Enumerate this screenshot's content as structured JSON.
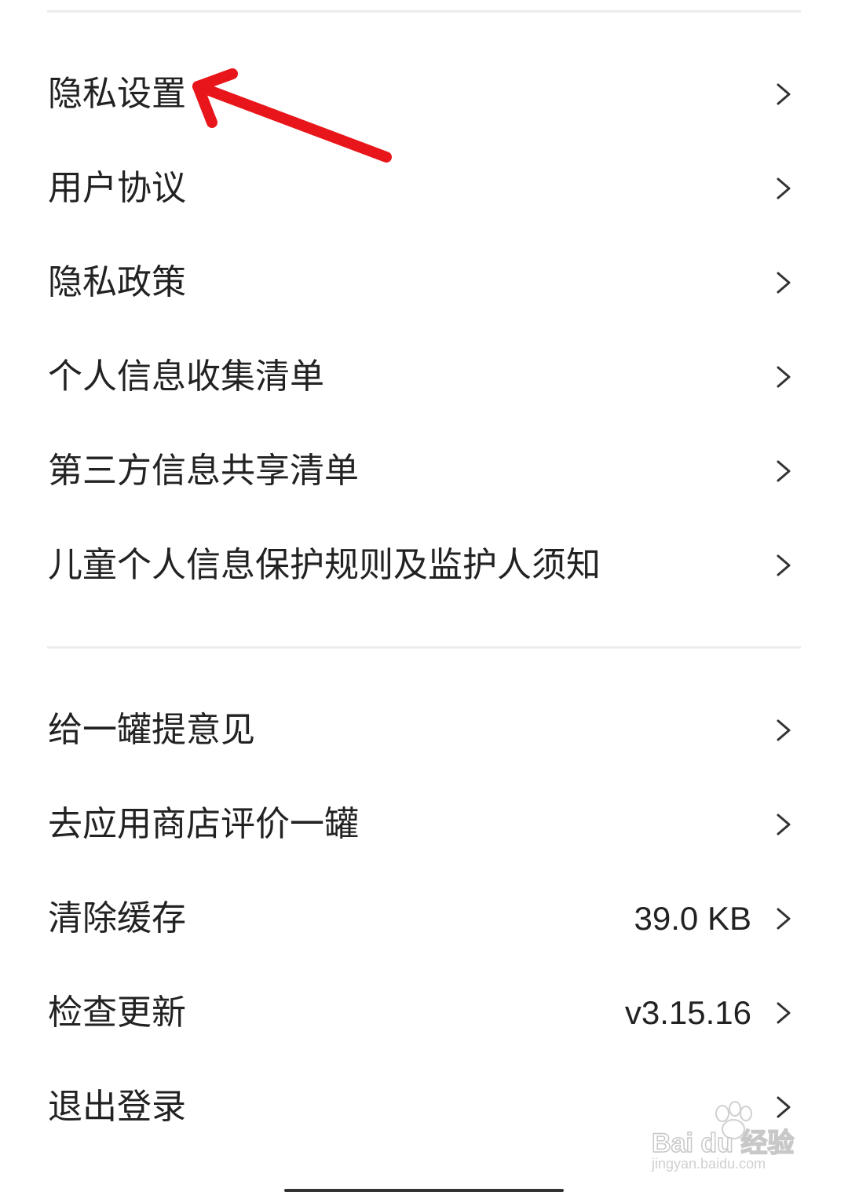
{
  "menu_group_1": [
    {
      "label": "隐私设置"
    },
    {
      "label": "用户协议"
    },
    {
      "label": "隐私政策"
    },
    {
      "label": "个人信息收集清单"
    },
    {
      "label": "第三方信息共享清单"
    },
    {
      "label": "儿童个人信息保护规则及监护人须知"
    }
  ],
  "menu_group_2": [
    {
      "label": "给一罐提意见"
    },
    {
      "label": "去应用商店评价一罐"
    },
    {
      "label": "清除缓存",
      "value": "39.0 KB"
    },
    {
      "label": "检查更新",
      "value": "v3.15.16"
    },
    {
      "label": "退出登录"
    }
  ],
  "watermark": {
    "brand": "Bai du 经验",
    "url": "jingyan.baidu.com"
  },
  "colors": {
    "text": "#222222",
    "divider": "#ececec",
    "annotation_arrow": "#e8161b"
  },
  "icons": {
    "chevron": "chevron-right-icon",
    "annotation": "red-arrow-annotation"
  }
}
